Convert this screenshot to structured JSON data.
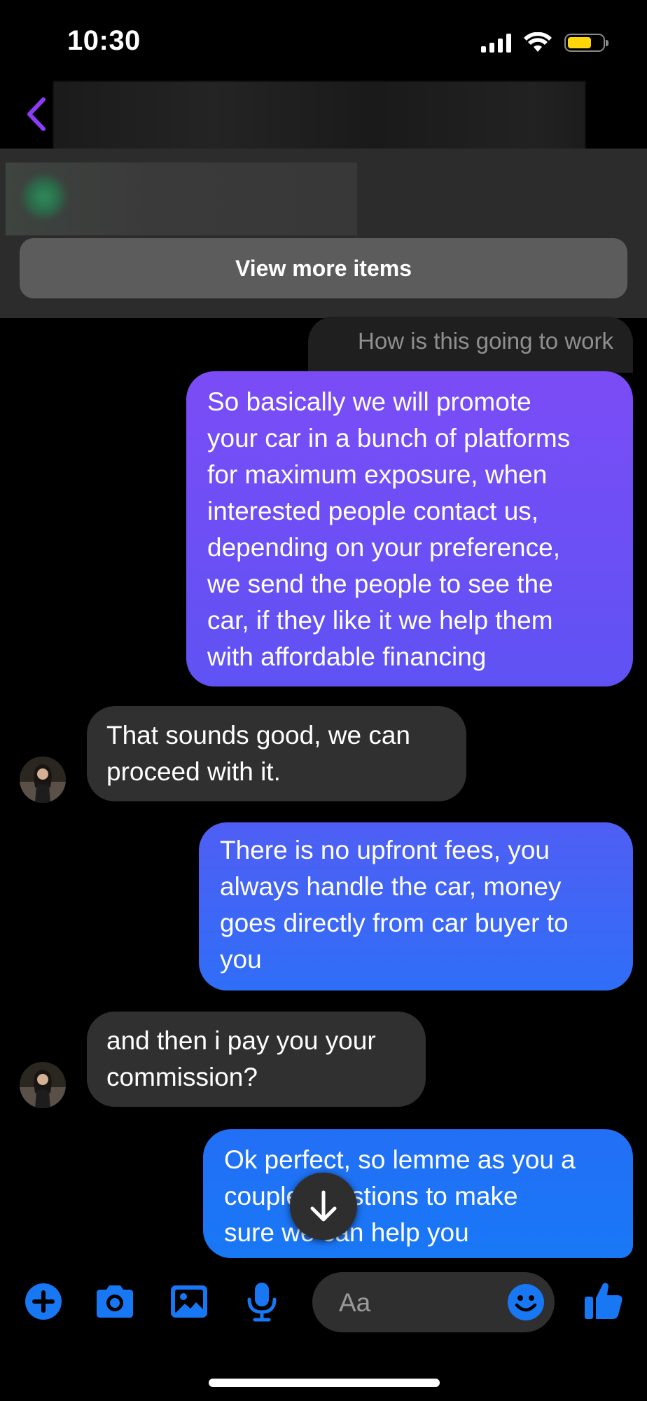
{
  "status_bar": {
    "time": "10:30"
  },
  "colors": {
    "accent_purple": "#8c3cf6",
    "accent_blue": "#1877f2",
    "battery": "#ffd60a"
  },
  "header": {
    "back_icon": "chevron-left-icon",
    "view_more_label": "View more items"
  },
  "messages": {
    "quoted": "How is this going to work",
    "m1": {
      "direction": "outgoing",
      "lines": [
        "So basically we will promote",
        "your car in a bunch of platforms",
        "for maximum exposure, when",
        "interested people contact us,",
        "depending on your preference,",
        "we send the people to see the",
        "car, if they like it we help them",
        "with affordable financing"
      ]
    },
    "m2": {
      "direction": "incoming",
      "lines": [
        "That sounds good, we can",
        "proceed with it."
      ]
    },
    "m3": {
      "direction": "outgoing",
      "lines": [
        "There is no upfront fees, you",
        "always handle the car, money",
        "goes directly from car buyer to",
        "you"
      ]
    },
    "m4": {
      "direction": "incoming",
      "lines": [
        "and then i pay you your",
        "commission?"
      ]
    },
    "m5": {
      "direction": "outgoing",
      "lines": [
        "Ok perfect, so lemme as you a",
        "couple questions to make",
        "sure we can help you"
      ]
    }
  },
  "toolbar": {
    "icons": [
      "plus-icon",
      "camera-icon",
      "gallery-icon",
      "microphone-icon",
      "emoji-icon",
      "thumbs-up-icon"
    ],
    "composer_placeholder": "Aa"
  }
}
